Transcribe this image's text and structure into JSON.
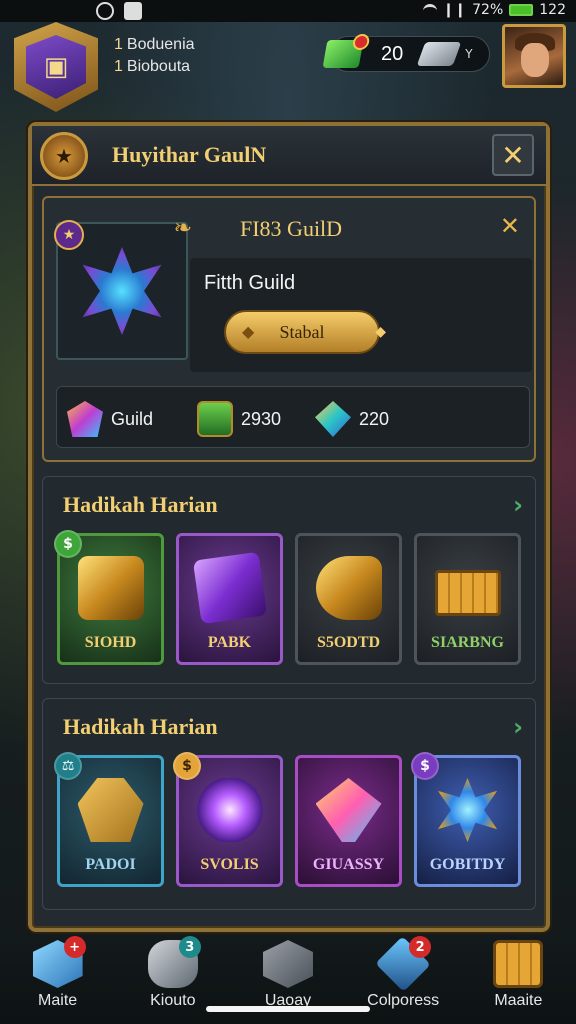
{
  "status_bar": {
    "signal": "❙❙",
    "battery_percent": "72%",
    "time": "122"
  },
  "hud": {
    "player_lines": [
      {
        "num": "1",
        "text": "Boduenia"
      },
      {
        "num": "1",
        "text": "Biobouta"
      }
    ],
    "gem_count": "20",
    "chevron": "Y"
  },
  "panel": {
    "title": "Huyithar GaulN",
    "close": "✕"
  },
  "guild": {
    "header": "FI83 GuilD",
    "close": "✕",
    "name": "Fitth Guild",
    "status_button": "Stabal",
    "stats": [
      {
        "icon": "gem-icon",
        "value": "Guild"
      },
      {
        "icon": "chest-icon",
        "value": "2930"
      },
      {
        "icon": "shard-icon",
        "value": "220"
      }
    ]
  },
  "sections": [
    {
      "title": "Hadikah Harian",
      "arrow": "›",
      "cards": [
        {
          "label": "SIOHD",
          "badge": "$",
          "theme": "green"
        },
        {
          "label": "PABK",
          "badge": "",
          "theme": "purple"
        },
        {
          "label": "S5ODTD",
          "badge": "",
          "theme": "dark"
        },
        {
          "label": "SIARBNG",
          "badge": "",
          "theme": "dark"
        }
      ]
    },
    {
      "title": "Hadikah Harian",
      "arrow": "›",
      "cards": [
        {
          "label": "PADOI",
          "badge": "⚖",
          "theme": "teal"
        },
        {
          "label": "SVOLIS",
          "badge": "$",
          "theme": "purple"
        },
        {
          "label": "GIUASSY",
          "badge": "",
          "theme": "magenta"
        },
        {
          "label": "GOBITDY",
          "badge": "$",
          "theme": "blue"
        }
      ]
    }
  ],
  "bottom_nav": [
    {
      "label": "Maite",
      "badge": "+",
      "badge_color": "#d42a2a"
    },
    {
      "label": "Kiouto",
      "badge": "3",
      "badge_color": "#1f8a8a"
    },
    {
      "label": "Uaoay",
      "badge": "",
      "badge_color": ""
    },
    {
      "label": "Colporess",
      "badge": "2",
      "badge_color": "#d42a2a"
    },
    {
      "label": "Maaite",
      "badge": "",
      "badge_color": ""
    }
  ]
}
